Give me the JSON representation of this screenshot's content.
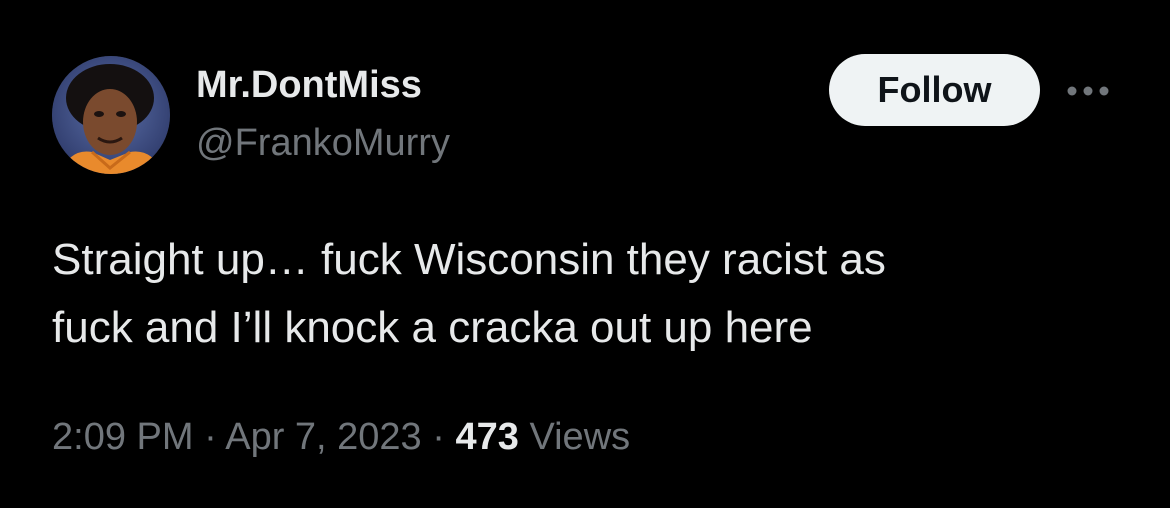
{
  "author": {
    "display_name": "Mr.DontMiss",
    "handle": "@FrankoMurry",
    "avatar_icon": "profile-photo"
  },
  "actions": {
    "follow_label": "Follow",
    "more_icon": "more-horizontal-icon"
  },
  "tweet": {
    "line1": "Straight up… fuck Wisconsin they racist as",
    "line2": "fuck and I’ll knock a cracka out up here"
  },
  "meta": {
    "time": "2:09 PM",
    "separator": "·",
    "date": "Apr 7, 2023",
    "views_count": "473",
    "views_label": "Views"
  },
  "colors": {
    "background": "#000000",
    "primary_text": "#e7e9ea",
    "secondary_text": "#71767b",
    "follow_button_bg": "#eff3f4"
  }
}
